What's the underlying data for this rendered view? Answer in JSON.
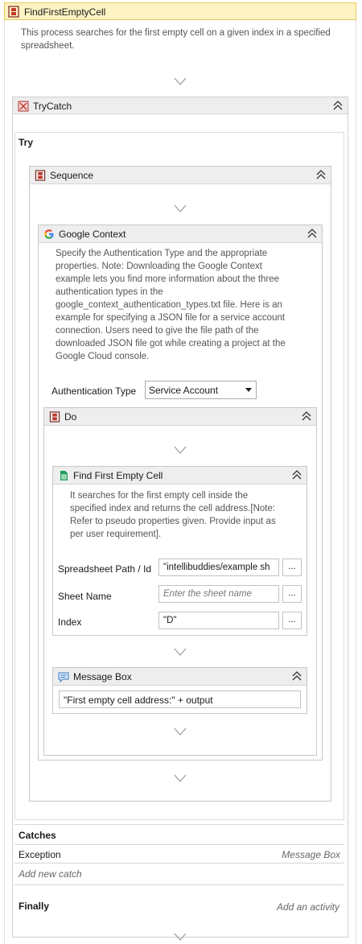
{
  "workflow": {
    "title": "FindFirstEmptyCell",
    "description": "This process searches for the first empty cell on a given index in a specified spreadsheet."
  },
  "trycatch": {
    "title": "TryCatch",
    "try_label": "Try",
    "catches_label": "Catches",
    "exception_label": "Exception",
    "exception_handler": "Message Box",
    "add_catch": "Add new catch",
    "finally_label": "Finally",
    "add_activity": "Add an activity"
  },
  "sequence": {
    "title": "Sequence"
  },
  "google_context": {
    "title": "Google Context",
    "description_lines": [
      "Specify the Authentication Type and the appropriate",
      "properties. Note: Downloading the Google Context",
      "example lets you find more information about the three",
      "authentication types in the",
      "google_context_authentication_types.txt file. Here is an",
      "example for specifying a JSON file for a service account",
      "connection. Users need to give the file path of the",
      "downloaded JSON file got while creating a project at the",
      "Google Cloud console."
    ],
    "auth_label": "Authentication Type",
    "auth_value": "Service Account"
  },
  "do": {
    "title": "Do"
  },
  "find_cell": {
    "title": "Find First Empty Cell",
    "description_lines": [
      "It searches for the first empty cell inside the",
      "specified index and returns the cell address.[Note:",
      "Refer to pseudo properties given. Provide input as",
      "per user requirement]."
    ],
    "fields": [
      {
        "label": "Spreadsheet Path / Id",
        "value": "\"intellibuddies/example sh",
        "placeholder": ""
      },
      {
        "label": "Sheet Name",
        "value": "",
        "placeholder": "Enter the sheet name"
      },
      {
        "label": "Index",
        "value": "\"D\"",
        "placeholder": ""
      }
    ],
    "dots": "..."
  },
  "message_box": {
    "title": "Message Box",
    "value": "\"First empty cell address:\" + output"
  },
  "colors": {
    "header_yellow": "#fdf2c2",
    "header_yellow_border": "#e8c95a",
    "activity_bar": "#eeeeee",
    "border": "#c8c8c8",
    "seq_icon_red": "#c0392b",
    "sheets_green": "#1e9e55",
    "google_blue": "#4285f4",
    "msg_blue": "#3b7fc4"
  }
}
